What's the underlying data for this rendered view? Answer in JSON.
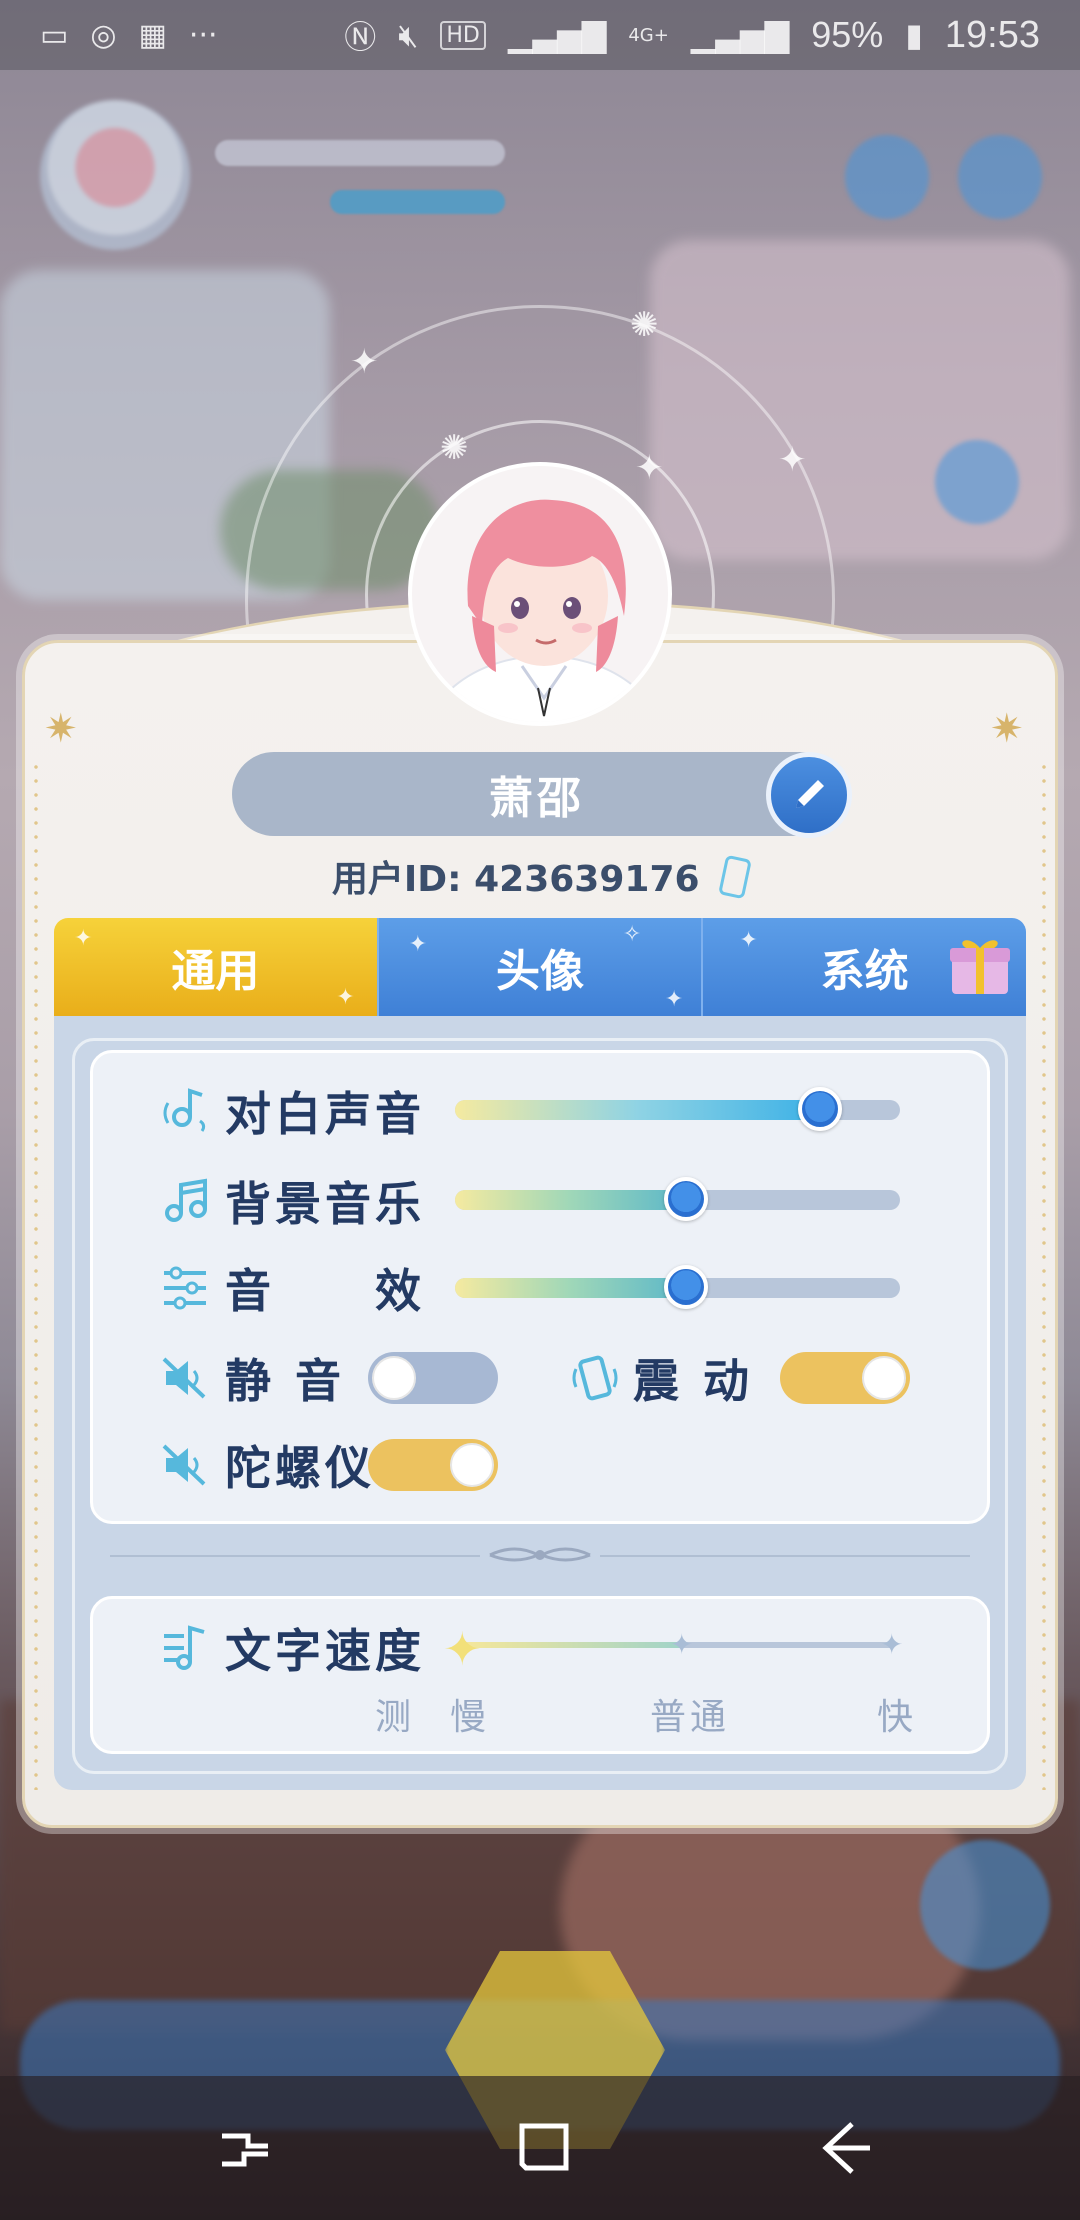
{
  "status_bar": {
    "battery": "95%",
    "time": "19:53",
    "icons": [
      "message-icon",
      "sync-icon",
      "gallery-icon",
      "more-icon",
      "nfc-icon",
      "mute-icon",
      "hd-icon",
      "signal-icon",
      "4g-icon",
      "signal-icon",
      "battery-icon"
    ]
  },
  "profile": {
    "name": "萧邵",
    "user_id_label": "用户ID:",
    "user_id": "423639176"
  },
  "tabs": [
    {
      "label": "通用",
      "active": true
    },
    {
      "label": "头像",
      "active": false
    },
    {
      "label": "系统",
      "active": false
    }
  ],
  "settings": {
    "dialogue_voice": {
      "label": "对白声音",
      "value": 0.82
    },
    "bgm": {
      "label": "背景音乐",
      "value": 0.52
    },
    "sfx": {
      "label": "音　　效",
      "value": 0.52
    },
    "mute": {
      "label": "静 音",
      "on": false
    },
    "vibrate": {
      "label": "震 动",
      "on": true
    },
    "gyroscope": {
      "label": "陀螺仪",
      "on": true
    },
    "text_speed": {
      "label": "文字速度",
      "options": [
        "测",
        "慢",
        "普通",
        "快"
      ],
      "selected": "慢"
    }
  },
  "colors": {
    "tab_active": "#f2c12e",
    "tab_inactive": "#4a8be0",
    "label": "#233a63",
    "knob": "#3a84e2",
    "toggle_on": "#ecc25f",
    "toggle_off": "#a7b8d3"
  }
}
